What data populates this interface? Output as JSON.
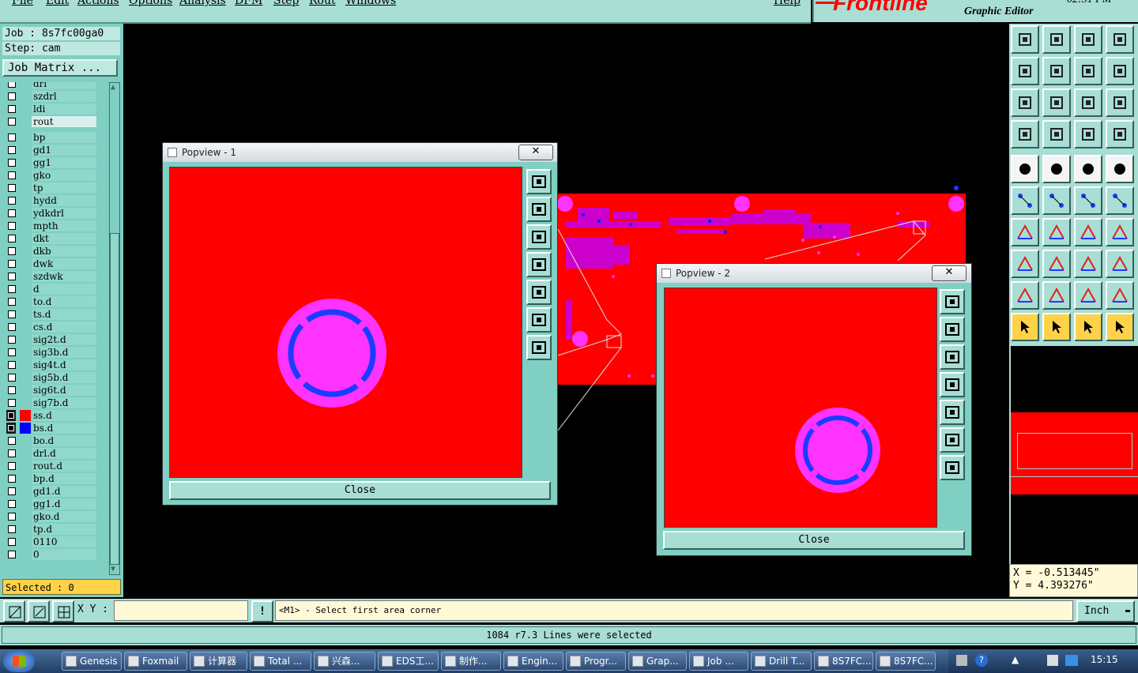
{
  "menu": {
    "items": [
      "File",
      "Edit",
      "Actions",
      "Options",
      "Analysis",
      "DFM",
      "Step",
      "Rout",
      "Windows"
    ],
    "help": "Help"
  },
  "brand": {
    "logo": "Frontline",
    "subtitle": "Graphic Editor",
    "clock": "02:31 PM"
  },
  "job": {
    "job_line": "Job : 8s7fc00ga0",
    "step_line": "Step: cam",
    "matrix_button": "Job Matrix ..."
  },
  "layers": {
    "group1": [
      "drl",
      "szdrl",
      "ldi",
      "rout"
    ],
    "group2": [
      "bp",
      "gd1",
      "gg1",
      "gko",
      "tp",
      "hydd",
      "ydkdrl",
      "mpth",
      "dkt",
      "dkb",
      "dwk",
      "szdwk",
      "d",
      "to.d",
      "ts.d",
      "cs.d",
      "sig2t.d",
      "sig3b.d",
      "sig4t.d",
      "sig5b.d",
      "sig6t.d",
      "sig7b.d",
      "ss.d",
      "bs.d",
      "bo.d",
      "drl.d",
      "rout.d",
      "bp.d",
      "gd1.d",
      "gg1.d",
      "gko.d",
      "tp.d",
      "0110",
      "0"
    ],
    "active_colors": {
      "ss.d": "#ff0000",
      "bs.d": "#0000ff"
    }
  },
  "selected_label": "Selected : 0",
  "coords": {
    "x": "X = -0.513445\"",
    "y": "Y = 4.393276\""
  },
  "cmd": {
    "xy_label": "X Y :",
    "xy_value": "",
    "prompt": "<M1> - Select first area corner",
    "units": "Inch"
  },
  "status": "1084 r7.3 Lines were selected",
  "popview1": {
    "title": "Popview - 1",
    "close_x": "✕",
    "close_button": "Close"
  },
  "popview2": {
    "title": "Popview - 2",
    "close_x": "✕",
    "close_button": "Close"
  },
  "taskbar": {
    "items": [
      "Genesis",
      "Foxmail",
      "计算器",
      "Total ...",
      "兴森...",
      "EDS工...",
      "制作...",
      "Engin...",
      "Progr...",
      "Grap...",
      "Job ...",
      "Drill T...",
      "8S7FC...",
      "8S7FC..."
    ],
    "time": "15:15"
  },
  "colors": {
    "board": "#ff0000",
    "pad": "#ff33ff",
    "ring": "#1a3cff",
    "panel": "#7fcfc2"
  }
}
